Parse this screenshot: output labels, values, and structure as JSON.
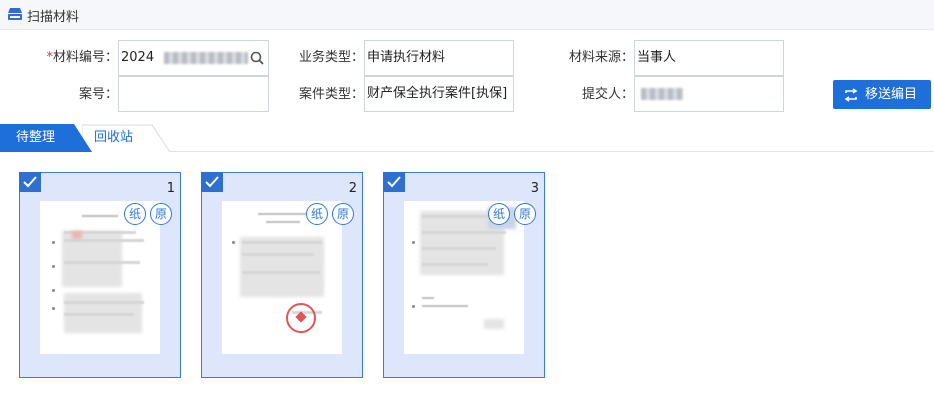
{
  "title": "扫描材料",
  "form": {
    "material_no_label": "材料编号：",
    "material_no_value": "2024",
    "case_no_label": "案号：",
    "case_no_value": "",
    "business_type_label": "业务类型：",
    "business_type_value": "申请执行材料",
    "case_type_label": "案件类型：",
    "case_type_value": "财产保全执行案件[执保]",
    "source_label": "材料来源：",
    "source_value": "当事人",
    "submitter_label": "提交人：",
    "submitter_value": ""
  },
  "actions": {
    "transfer_label": "移送编目"
  },
  "tabs": [
    {
      "label": "待整理",
      "active": true
    },
    {
      "label": "回收站",
      "active": false
    }
  ],
  "pages": [
    {
      "number": "1",
      "badge_paper": "纸",
      "badge_original": "原",
      "selected": true
    },
    {
      "number": "2",
      "badge_paper": "纸",
      "badge_original": "原",
      "selected": true
    },
    {
      "number": "3",
      "badge_paper": "纸",
      "badge_original": "原",
      "selected": true
    }
  ],
  "colors": {
    "accent": "#1e6fd9",
    "card_bg": "#dde6fb",
    "card_border": "#3d7bd8",
    "stamp": "#d83a3a"
  },
  "icons": {
    "title": "scanner-icon",
    "search": "search-icon",
    "transfer": "swap-arrows-icon",
    "check": "checkmark-icon"
  }
}
